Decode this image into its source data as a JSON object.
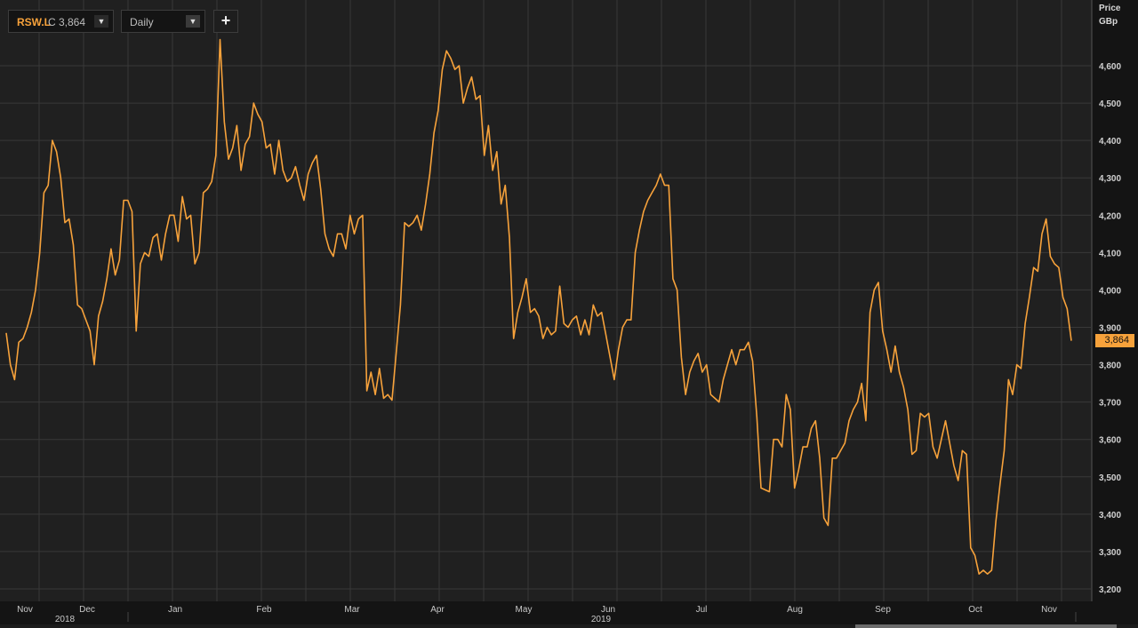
{
  "toolbar": {
    "ric": "RSW.L",
    "close_label": "C 3,864",
    "ric_dropdown_glyph": "▼",
    "interval": "Daily",
    "interval_dropdown_glyph": "▼",
    "add_glyph": "+"
  },
  "axis": {
    "title": "Price",
    "unit": "GBp",
    "last_price_label": "3,864"
  },
  "colors": {
    "line": "#f7a23b",
    "plot_background": "#202020",
    "grid": "#383838",
    "page_background": "#000000"
  },
  "chart_data": {
    "type": "line",
    "title": "",
    "xlabel": "",
    "ylabel": "Price",
    "unit": "GBp",
    "ylim": [
      3200,
      4640
    ],
    "grid": true,
    "legend": "none",
    "x_ticks": [
      "Nov",
      "Dec",
      "Jan",
      "Feb",
      "Mar",
      "Apr",
      "May",
      "Jun",
      "Jul",
      "Aug",
      "Sep",
      "Oct",
      "Nov"
    ],
    "x_years": [
      "2018",
      "2019"
    ],
    "y_ticks": [
      "3,200",
      "3,300",
      "3,400",
      "3,500",
      "3,600",
      "3,700",
      "3,800",
      "3,900",
      "4,000",
      "4,100",
      "4,200",
      "4,300",
      "4,400",
      "4,500",
      "4,600"
    ],
    "last_value": 3864,
    "series": [
      {
        "values": [
          3885,
          3800,
          3760,
          3860,
          3870,
          3900,
          3940,
          4000,
          4100,
          4260,
          4280,
          4400,
          4370,
          4300,
          4180,
          4190,
          4120,
          3960,
          3950,
          3920,
          3890,
          3800,
          3930,
          3970,
          4030,
          4110,
          4040,
          4080,
          4240,
          4240,
          4210,
          3890,
          4070,
          4100,
          4090,
          4140,
          4150,
          4080,
          4150,
          4200,
          4200,
          4130,
          4250,
          4190,
          4200,
          4070,
          4100,
          4260,
          4270,
          4290,
          4360,
          4670,
          4450,
          4350,
          4380,
          4440,
          4320,
          4390,
          4410,
          4500,
          4470,
          4450,
          4380,
          4390,
          4310,
          4400,
          4320,
          4290,
          4300,
          4330,
          4280,
          4240,
          4310,
          4340,
          4360,
          4270,
          4150,
          4110,
          4090,
          4150,
          4150,
          4110,
          4200,
          4150,
          4190,
          4200,
          3730,
          3780,
          3720,
          3790,
          3710,
          3720,
          3705,
          3830,
          3960,
          4180,
          4170,
          4180,
          4200,
          4160,
          4230,
          4310,
          4420,
          4480,
          4590,
          4640,
          4620,
          4590,
          4600,
          4500,
          4540,
          4570,
          4510,
          4520,
          4360,
          4440,
          4320,
          4370,
          4230,
          4280,
          4140,
          3870,
          3940,
          3980,
          4030,
          3940,
          3950,
          3930,
          3870,
          3900,
          3880,
          3890,
          4010,
          3910,
          3900,
          3920,
          3930,
          3880,
          3920,
          3880,
          3960,
          3930,
          3940,
          3880,
          3820,
          3760,
          3840,
          3900,
          3920,
          3920,
          4100,
          4160,
          4210,
          4240,
          4260,
          4280,
          4310,
          4280,
          4280,
          4030,
          4000,
          3820,
          3720,
          3780,
          3810,
          3830,
          3780,
          3800,
          3720,
          3710,
          3700,
          3760,
          3800,
          3840,
          3800,
          3840,
          3840,
          3860,
          3810,
          3660,
          3470,
          3465,
          3460,
          3600,
          3600,
          3580,
          3720,
          3680,
          3470,
          3520,
          3580,
          3580,
          3630,
          3650,
          3550,
          3390,
          3370,
          3550,
          3550,
          3570,
          3590,
          3650,
          3680,
          3700,
          3750,
          3650,
          3940,
          4000,
          4020,
          3890,
          3840,
          3780,
          3850,
          3780,
          3740,
          3680,
          3560,
          3570,
          3670,
          3660,
          3670,
          3580,
          3550,
          3600,
          3650,
          3590,
          3530,
          3490,
          3570,
          3560,
          3310,
          3290,
          3240,
          3250,
          3240,
          3250,
          3380,
          3480,
          3570,
          3760,
          3720,
          3800,
          3790,
          3910,
          3980,
          4060,
          4050,
          4150,
          4190,
          4090,
          4070,
          4060,
          3980,
          3950,
          3864
        ]
      }
    ]
  }
}
